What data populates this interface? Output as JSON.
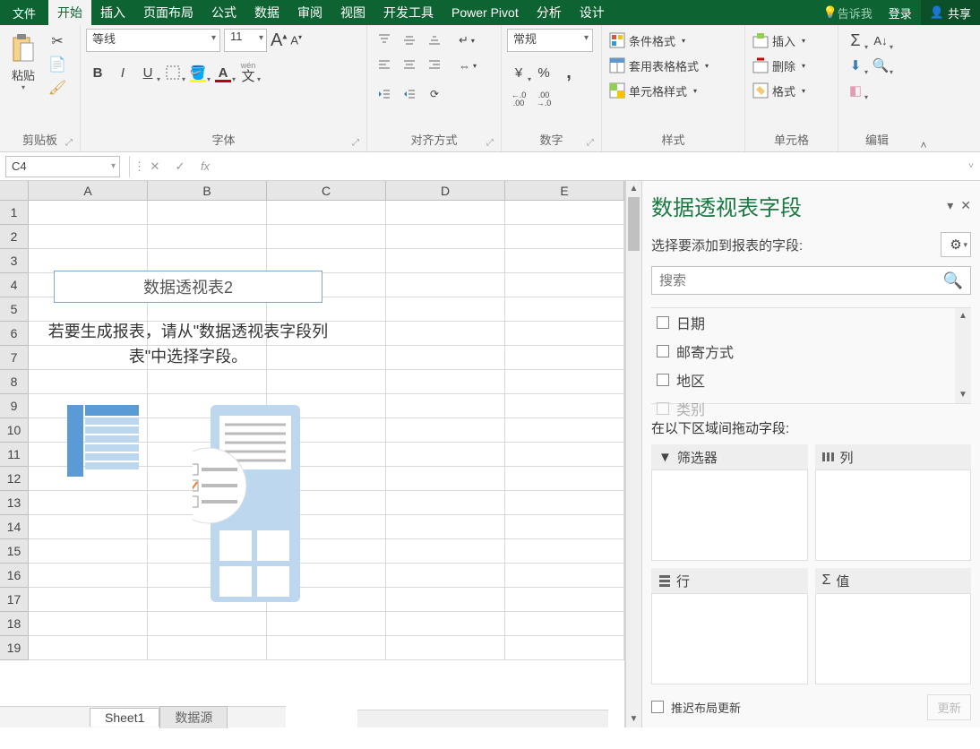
{
  "menubar": {
    "file": "文件",
    "tabs": [
      "开始",
      "插入",
      "页面布局",
      "公式",
      "数据",
      "审阅",
      "视图",
      "开发工具",
      "Power Pivot",
      "分析",
      "设计"
    ],
    "active_tab": "开始",
    "tell_me": "告诉我",
    "login": "登录",
    "share": "共享"
  },
  "ribbon": {
    "clipboard": {
      "paste": "粘贴",
      "label": "剪贴板"
    },
    "font": {
      "name": "等线",
      "size": "11",
      "bold": "B",
      "italic": "I",
      "underline": "U",
      "wen_label": "wén",
      "wen_char": "文",
      "label": "字体"
    },
    "align": {
      "wrap": "自动换行",
      "merge": "合并后居中",
      "label": "对齐方式"
    },
    "number": {
      "format": "常规",
      "inc": ".0",
      "inc2": ".00",
      "dec": ".00",
      "dec2": "→.0",
      "label": "数字",
      "percent": "%",
      "comma": ",",
      "currency": "¥"
    },
    "styles": {
      "cond": "条件格式",
      "table": "套用表格格式",
      "cell": "单元格样式",
      "label": "样式"
    },
    "cells": {
      "insert": "插入",
      "delete": "删除",
      "format": "格式",
      "label": "单元格"
    },
    "editing": {
      "label": "编辑"
    }
  },
  "formula_bar": {
    "name_box": "C4",
    "fx": "fx"
  },
  "grid": {
    "columns": [
      "A",
      "B",
      "C",
      "D",
      "E"
    ],
    "rows": 19,
    "pivot_title": "数据透视表2",
    "pivot_msg_l1": "若要生成报表，请从\"数据透视表字段列",
    "pivot_msg_l2": "表\"中选择字段。"
  },
  "sheets": {
    "tabs": [
      "Sheet1",
      "数据源"
    ],
    "active": "Sheet1"
  },
  "pane": {
    "title": "数据透视表字段",
    "subtitle": "选择要添加到报表的字段:",
    "search_ph": "搜索",
    "fields": [
      "日期",
      "邮寄方式",
      "地区",
      "类别"
    ],
    "drag_label": "在以下区域间拖动字段:",
    "areas": {
      "filter": "筛选器",
      "columns": "列",
      "rows": "行",
      "values": "值"
    },
    "defer": "推迟布局更新",
    "update": "更新"
  }
}
